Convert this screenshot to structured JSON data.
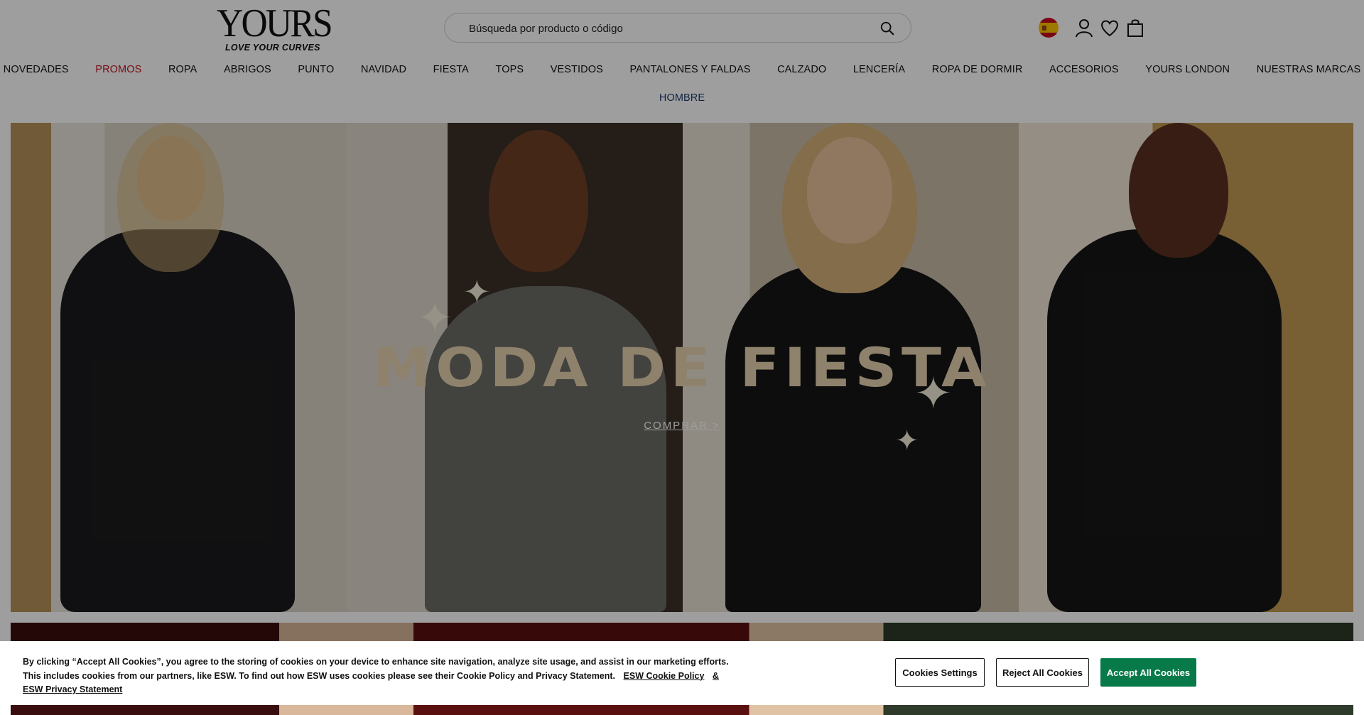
{
  "brand": {
    "logo_word": "YOURS",
    "tagline": "LOVE YOUR CURVES"
  },
  "search": {
    "placeholder": "Búsqueda por producto o código"
  },
  "nav": {
    "items": [
      "NOVEDADES",
      "PROMOS",
      "ROPA",
      "ABRIGOS",
      "PUNTO",
      "NAVIDAD",
      "FIESTA",
      "TOPS",
      "VESTIDOS",
      "PANTALONES Y FALDAS",
      "CALZADO",
      "LENCERÍA",
      "ROPA DE DORMIR",
      "ACCESORIOS",
      "YOURS LONDON",
      "NUESTRAS MARCAS"
    ],
    "second_row": "HOMBRE"
  },
  "hero": {
    "title": "MODA DE FIESTA",
    "cta": "COMPRAR >"
  },
  "cookie": {
    "text": "By clicking “Accept All Cookies”, you agree to the storing of cookies on your device to enhance site navigation, analyze site usage, and assist in our marketing efforts. This includes cookies from our partners, like ESW. To find out how ESW uses cookies please see their Cookie Policy and Privacy Statement.",
    "link_policy": "ESW Cookie Policy",
    "link_privacy": "& ESW Privacy Statement",
    "settings_label": "Cookies Settings",
    "reject_label": "Reject All Cookies",
    "accept_label": "Accept All Cookies"
  },
  "colors": {
    "promo": "#c4121f",
    "men_link": "#1c3a6e",
    "accept_button": "#087a4a"
  },
  "icons": [
    "search-icon",
    "spain-flag-icon",
    "account-icon",
    "wishlist-heart-icon",
    "bag-icon"
  ]
}
